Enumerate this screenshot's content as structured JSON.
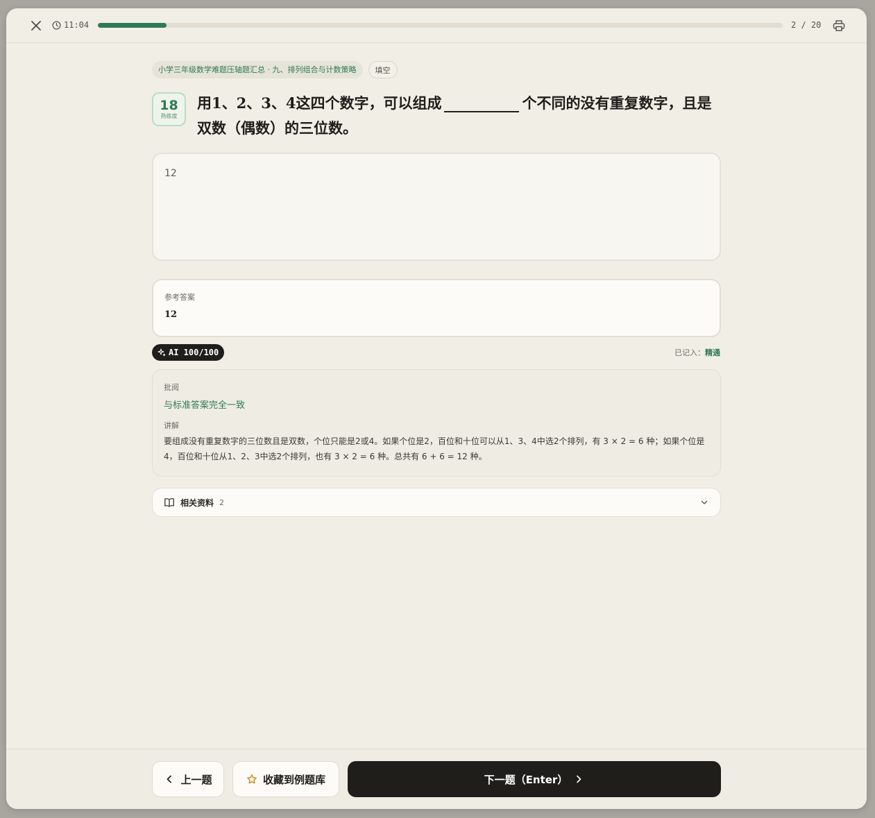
{
  "topbar": {
    "timer": "11:04",
    "progress_fraction": 0.1,
    "counter": "2 / 20"
  },
  "tags": {
    "path": "小学三年级数学难题压轴题汇总 · 九、排列组合与计数策略",
    "type": "填空"
  },
  "badge": {
    "number": "18",
    "label": "熟练度"
  },
  "question": {
    "before": "用1、2、3、4这四个数字，可以组成",
    "after": "个不同的没有重复数字，且是双数（偶数）的三位数。"
  },
  "answer": {
    "value": "12"
  },
  "reference": {
    "label": "参考答案",
    "value": "12"
  },
  "ai": {
    "score": "AI 100/100"
  },
  "recorded": {
    "label": "已记入：",
    "level": "精通"
  },
  "review": {
    "label": "批阅",
    "verdict": "与标准答案完全一致",
    "explain_label": "讲解",
    "explanation": "要组成没有重复数字的三位数且是双数，个位只能是2或4。如果个位是2，百位和十位可以从1、3、4中选2个排列，有 3 × 2 = 6 种；如果个位是4，百位和十位从1、2、3中选2个排列，也有 3 × 2 = 6 种。总共有 6 + 6 = 12 种。"
  },
  "related": {
    "label": "相关资料",
    "count": "2"
  },
  "footer": {
    "prev_label": "上一题",
    "fav_label": "收藏到例题库",
    "next_label": "下一题（Enter）"
  },
  "colors": {
    "accent": "#2f7a55",
    "dark": "#1f1e1b",
    "background": "#f1eee6"
  },
  "icons": [
    "close-icon",
    "clock-icon",
    "print-icon",
    "sparkle-icon",
    "book-icon",
    "chevron-down-icon",
    "chevron-left-icon",
    "star-icon",
    "chevron-right-icon"
  ]
}
